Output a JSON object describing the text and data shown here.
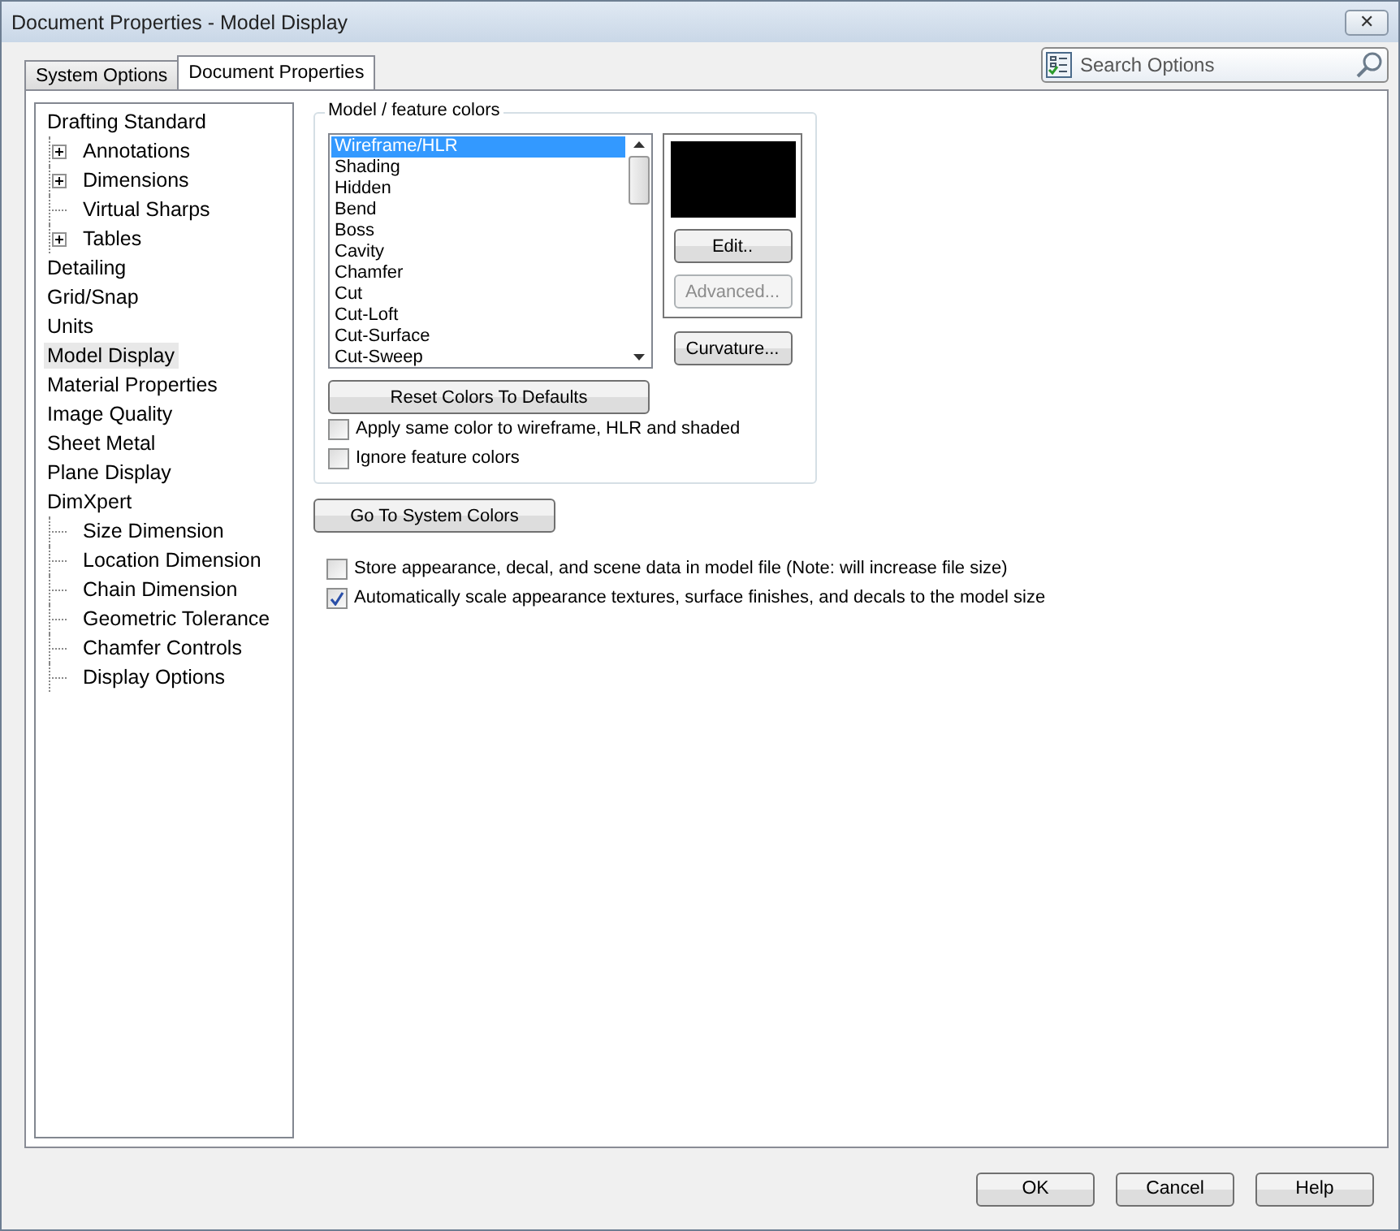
{
  "window": {
    "title": "Document Properties - Model Display",
    "close": "✕"
  },
  "tabs": [
    {
      "label": "System Options",
      "selected": false
    },
    {
      "label": "Document Properties",
      "selected": true
    }
  ],
  "search": {
    "placeholder": "Search Options"
  },
  "tree": [
    {
      "label": "Drafting Standard",
      "selected": false,
      "children": [
        {
          "label": "Annotations",
          "selected": false,
          "expanded": false
        },
        {
          "label": "Dimensions",
          "selected": false,
          "expanded": false
        },
        {
          "label": "Virtual Sharps",
          "selected": false
        },
        {
          "label": "Tables",
          "selected": false,
          "expanded": false
        }
      ]
    },
    {
      "label": "Detailing",
      "selected": false
    },
    {
      "label": "Grid/Snap",
      "selected": false
    },
    {
      "label": "Units",
      "selected": false
    },
    {
      "label": "Model Display",
      "selected": true
    },
    {
      "label": "Material Properties",
      "selected": false
    },
    {
      "label": "Image Quality",
      "selected": false
    },
    {
      "label": "Sheet Metal",
      "selected": false
    },
    {
      "label": "Plane Display",
      "selected": false
    },
    {
      "label": "DimXpert",
      "selected": false,
      "children": [
        {
          "label": "Size Dimension",
          "selected": false
        },
        {
          "label": "Location Dimension",
          "selected": false
        },
        {
          "label": "Chain Dimension",
          "selected": false
        },
        {
          "label": "Geometric Tolerance",
          "selected": false
        },
        {
          "label": "Chamfer Controls",
          "selected": false
        },
        {
          "label": "Display Options",
          "selected": false
        }
      ]
    }
  ],
  "model_colors": {
    "title": "Model / feature colors",
    "items": [
      {
        "label": "Wireframe/HLR",
        "selected": true
      },
      {
        "label": "Shading",
        "selected": false
      },
      {
        "label": "Hidden",
        "selected": false
      },
      {
        "label": "Bend",
        "selected": false
      },
      {
        "label": "Boss",
        "selected": false
      },
      {
        "label": "Cavity",
        "selected": false
      },
      {
        "label": "Chamfer",
        "selected": false
      },
      {
        "label": "Cut",
        "selected": false
      },
      {
        "label": "Cut-Loft",
        "selected": false
      },
      {
        "label": "Cut-Surface",
        "selected": false
      },
      {
        "label": "Cut-Sweep",
        "selected": false
      }
    ],
    "side_buttons": [
      {
        "label": "Edit..",
        "disabled": false
      },
      {
        "label": "Advanced...",
        "disabled": true
      }
    ],
    "curvature": "Curvature...",
    "reset": "Reset Colors To Defaults",
    "checkboxes": [
      {
        "label": "Apply same color to wireframe, HLR and shaded",
        "checked": false
      },
      {
        "label": "Ignore feature colors",
        "checked": false
      }
    ]
  },
  "system_colors": "Go To System Colors",
  "options": [
    {
      "label": "Store appearance, decal, and scene data in model file (Note: will increase file size)",
      "checked": false
    },
    {
      "label": "Automatically scale appearance textures, surface finishes, and decals to the model size",
      "checked": true
    }
  ],
  "buttons": [
    "OK",
    "Cancel",
    "Help"
  ]
}
